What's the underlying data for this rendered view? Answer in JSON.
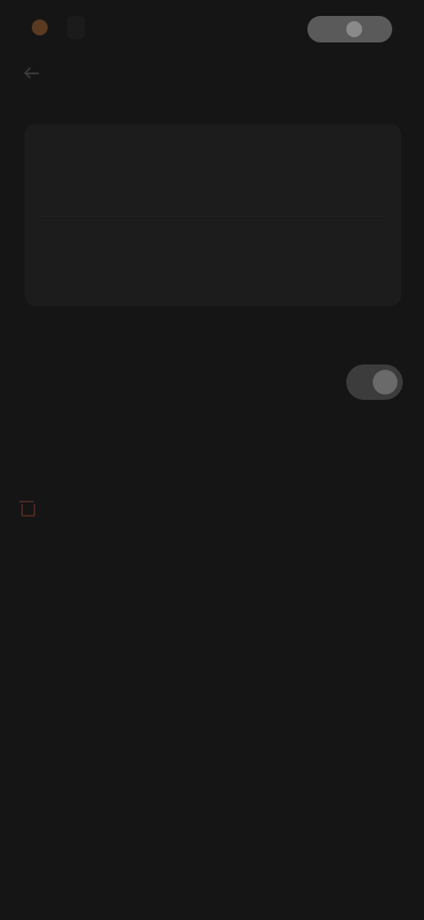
{
  "header": {
    "logo_text": "",
    "login_label": ""
  },
  "nav": {
    "back_label": ""
  },
  "account_card": {
    "rows": [
      {
        "label": "",
        "value": "",
        "meta": ""
      },
      {
        "label": "",
        "value": "",
        "meta": ""
      }
    ]
  },
  "preferences": {
    "toggle_title": "",
    "toggle_desc": "",
    "toggle_on": true
  },
  "danger_zone": {
    "title": "",
    "description": "",
    "delete_label": ""
  },
  "colors": {
    "background": "#151515",
    "card": "#1c1c1c",
    "danger": "#4a2620",
    "toggle_track": "#3c3c3c"
  }
}
